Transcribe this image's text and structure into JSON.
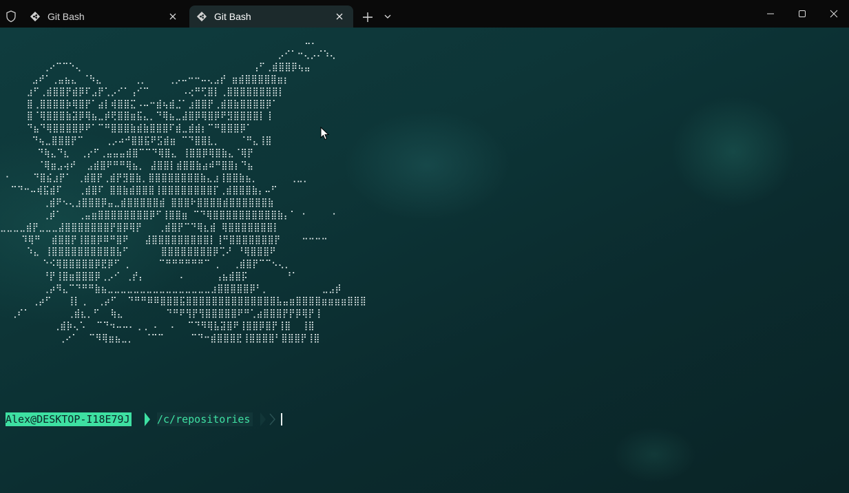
{
  "window": {
    "shield_icon": "shield-icon",
    "tabs": [
      {
        "label": "Git Bash",
        "icon": "git-bash-icon",
        "active": false
      },
      {
        "label": "Git Bash",
        "icon": "git-bash-icon",
        "active": true
      }
    ],
    "controls": {
      "new_tab_icon": "plus-icon",
      "dropdown_icon": "chevron-down-icon",
      "minimize_icon": "minimize-icon",
      "maximize_icon": "maximize-icon",
      "close_icon": "close-icon"
    }
  },
  "terminal": {
    "ascii_art": "                                                         ⠤⠄\n                                                    ⡠⠊⠁⠒⢄⡠⠌⠱⢄\n        ⢀⠔⠉⠉⠑⢄                                ⢠⠋⢀⣾⣿⣿⡿⢦⣤\n      ⣠⠞⠁⢀⣤⣦⣄ ⠈⠳⣄      ⢀⡀    ⢀⡠⠤⠒⠒⠤⢄⣠⡞ ⣶⣾⣿⣿⣿⣿⣿⣶⡆\n     ⣰⠋⢀⣾⣿⣿⡟⣾⡿⠏⣠⡟⢁⡠⠊⠁⢠⠊⠉      ⠠⢔⠛⢋⣿⡇⢀⣿⣿⣿⣿⣿⣿⣿⣿⡇\n     ⣿⢀⣿⣿⣿⣿⡷⢿⣿⡟⠁⣴⡇⢾⣿⣿⣍⠠⠤⠒⣾⢦⣾⣈⠁⣰⣿⣿⡟⢀⣾⣿⣷⣿⣿⣿⣿⡿⠁\n     ⣿⠈⢿⣿⣿⣿⣷⣽⡿⢿⣦⣀⡾⢟⣿⣿⣶⣯⣄⡀⠙⢿⣦⣀⣼⣿⡿⢿⣿⡿⠟⣻⣿⣿⣿⣿⡇⢸\n     ⠙⣦⠙⢿⣿⣿⣿⣿⡿⠟⠁⠉⠛⣿⣿⣿⣷⣾⣷⣿⣿⣿⠏⣾⣀⣾⣾⡆⠉⠛⣿⣿⣿⡿⠁\n      ⠙⢦⣀⣿⣿⣿⡟⠉    ⢀⡠⠴⠚⣿⣿⣯⠟⣫⣾⣶ ⠉⠙⣿⣿⣇⡀⠀⠀⠀⠈⠛⣄⢸⣿\n       ⠙⢷⣄⠙⣆  ⢀⡔⠋⢀⣤⣤⣤⣾⣿⠉⠉⠙⢿⣿⣄ ⢸⣿⣿⡿⢿⣿⣷⣄⠈⢿⡟\n       ⠈⢿⣶⣠⢴⠞  ⣠⣾⣿⠟⠛⠛⢿⣦⡀ ⣼⣿⣿⡇⣾⣿⣿⣷⣴⠾⠛⣿⣿⡆⠙⣦\n ⠂    ⠙⣿⣮⣰⡟⠁ ⢀⣾⣿⡟⢀⣾⡟⣻⣿⣷⡀⣿⣿⣿⣿⣿⣿⣿⣿⣷⣄⣰⢸⣿⣿⣷⣦⡀      ⢀⣀⡀\n  ⠉⠙⠒⠤⢾⣯⣾⠏   ⢀⣾⣿⠏ ⣿⣿⣷⣾⣿⣿⣿⢸⣿⣿⣿⣿⣿⣿⣿⣿⡏⢀⣾⣿⣿⣿⣷⡄⠤⠋\n        ⢀⣾⠟⠢⢄⣰⣿⣿⣿⡿⣤⣀⣾⣿⣿⣿⣿⣿⣾ ⣿⣿⣿⠗⣿⣿⣿⣿⣾⣿⣿⣿⣿⣿⣿⣷\n        ⢀⡾⠁   ⢀⣤⣶⣿⣿⣿⣿⣿⣿⣿⣿⡿⠋⢸⣿⣿⣶ ⠉⠙⢿⣿⣿⣿⣿⣿⣿⣿⣿⣿⣿⣷⡄⠁ ⠂    ⠐\n⣀⣀⣀⣀⣾⡟⣀⣀⣀⣼⣿⣿⣿⣿⣿⣿⣿⡟⣿⡿⢿⡟   ⢀⣾⣿⡟⠉⠙⢿⣆⣾ ⢿⣿⣿⣿⣿⣿⣿⣿⡇\n    ⠹⢿⠛  ⣾⣿⣿⡟⢸⣿⣿⡿⠿⠛⣿⠟   ⣼⣿⣿⣿⣿⣿⣿⣿⣿⣿⡇⢸⠛⣿⣿⣿⣿⣿⣿⣿⡟    ⠒⠒⠒⠒\n     ⠱⣄ ⢸⣿⣿⣿⣿⣿⣿⣿⣿⣿⣿⣧⠋      ⣿⣿⣿⣿⣿⣿⣿⣿⡿⢉⠜ ⠘⢿⣿⣿⣿⠟\n        ⠑⠪⢿⣿⣿⣿⣿⣿⡿⣟⡿⠋ ⡀     ⠉⠛⠛⠛⠛⠛⠛⠉ ⡀  ⢀⣾⣿⡟⠉⠉⠢⢄⡀\n        ⠘⡟⢸⣿⣶⣿⣿⣿⡿⢀⡠⠊ ⢀⡞⡄      ⠠      ⢠⣦⣾⣿⡯       ⠘⠁\n        ⢀⡴⠻⣄⠉⠙⠛⠛⣷⣦⣀⣀⣀⣀⣀⣀⣀⣀⣀⣀⣀⣀⣀⣀⣀⣀⣰⣿⣿⣿⣿⣿⡿⠃⡀          ⣀⣠⡾\n      ⢀⡴⠋   ⢸⡇⢀  ⢀⡴⠋  ⠙⠛⠛⠿⠿⣿⣿⣿⣯⣿⣿⣿⣿⣿⣿⣿⣿⣿⣿⣿⣿⣿⣿⣧⣤⣶⣿⣿⣿⣿⣶⣶⣶⣶⣿⣿⣿\n  ⢀⠎⠁       ⢀⣾⣆⡀⠋  ⢷⣄        ⠙⠛⠟⢻⡟⢻⣿⣿⣿⣿⣿⠟⠛⢁⣴⣿⣿⣿⡟⡟⡿⢿⡟⢸\n          ⢀⣾⡷⢄⠡  ⠉⠙⠲⠤⠤⠄⢀⢀ ⠄  ⠄  ⠉⠙⠻⢿⣧⣽⣿⠟⢸⣿⣿⡿⣿⡟⢸⣿  ⢸⣿\n           ⢀⠔⠁  ⠉⠻⢿⣶⣦⣀⡀  ⠈⠉⠉     ⠉⠙⠒⣾⣿⣿⣿⣟⢸⣿⣿⣿⣿⠃⣿⣿⣿⡟⢸⣿",
    "prompt": {
      "user_host": "Alex@DESKTOP-I18E79J",
      "path": "/c/repositories"
    },
    "colors": {
      "prompt_accent": "#3ee0a2",
      "background": "#0d3537",
      "text": "#e8f0f0"
    }
  }
}
